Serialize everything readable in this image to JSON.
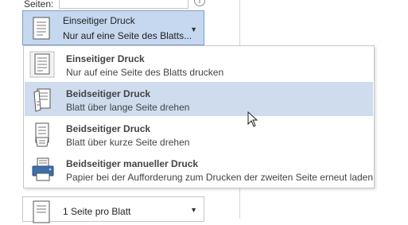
{
  "page_range": {
    "label": "Seiten:",
    "info_symbol": "i"
  },
  "print_mode_dropdown": {
    "title": "Einseitiger Druck",
    "subtitle": "Nur auf eine Seite des Blatts...",
    "caret": "▼"
  },
  "print_mode_menu": {
    "items": [
      {
        "title": "Einseitiger Druck",
        "desc": "Nur auf eine Seite des Blatts drucken",
        "icon": "single-sided-page-icon"
      },
      {
        "title": "Beidseitiger Druck",
        "desc": "Blatt über lange Seite drehen",
        "icon": "duplex-long-edge-icon"
      },
      {
        "title": "Beidseitiger Druck",
        "desc": "Blatt über kurze Seite drehen",
        "icon": "duplex-short-edge-icon"
      },
      {
        "title": "Beidseitiger manueller Druck",
        "desc": "Papier bei der Aufforderung zum Drucken der zweiten Seite erneut laden",
        "icon": "manual-duplex-printer-icon"
      }
    ],
    "hovered_index": 1
  },
  "pages_per_sheet_dropdown": {
    "label": "1 Seite pro Blatt",
    "caret": "▼"
  },
  "colors": {
    "selected_bg": "#c5d8f0",
    "hover_bg": "#cfdcee",
    "border": "#c6c6c6"
  }
}
